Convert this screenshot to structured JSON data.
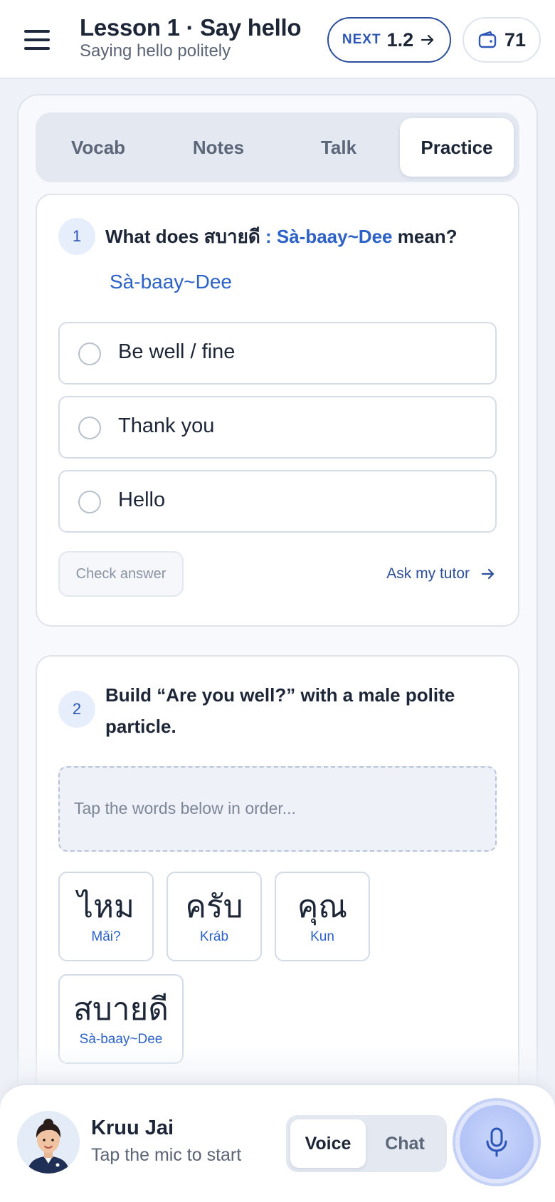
{
  "header": {
    "lesson_title": "Lesson 1 · Say hello",
    "lesson_subtitle": "Saying hello politely",
    "next_label": "NEXT",
    "next_lesson": "1.2",
    "wallet_count": "71"
  },
  "tabs": [
    {
      "label": "Vocab",
      "active": false
    },
    {
      "label": "Notes",
      "active": false
    },
    {
      "label": "Talk",
      "active": false
    },
    {
      "label": "Practice",
      "active": true
    }
  ],
  "question1": {
    "number": "1",
    "prompt_prefix": "What does สบายดี ",
    "prompt_highlight": ": Sà-baay~Dee",
    "prompt_suffix": " mean?",
    "transliteration": "Sà-baay~Dee",
    "options": [
      {
        "label": "Be well / fine"
      },
      {
        "label": "Thank you"
      },
      {
        "label": "Hello"
      }
    ],
    "check_label": "Check answer",
    "tutor_label": "Ask my tutor"
  },
  "question2": {
    "number": "2",
    "prompt_line1": "Build “Are you well?” with a male polite",
    "prompt_line2": "particle.",
    "dropzone_placeholder": "Tap the words below in order...",
    "chips": [
      {
        "thai": "ไหม",
        "roman": "Mǎi?"
      },
      {
        "thai": "ครับ",
        "roman": "Kráb"
      },
      {
        "thai": "คุณ",
        "roman": "Kun"
      },
      {
        "thai": "สบายดี",
        "roman": "Sà-baay~Dee"
      }
    ]
  },
  "footer": {
    "tutor_name": "Kruu Jai",
    "tutor_status": "Tap the mic to start",
    "modes": [
      {
        "label": "Voice",
        "active": true
      },
      {
        "label": "Chat",
        "active": false
      }
    ]
  },
  "colors": {
    "accent": "#2c55b8",
    "highlight": "#2c62c8",
    "background": "#eef1f7"
  }
}
